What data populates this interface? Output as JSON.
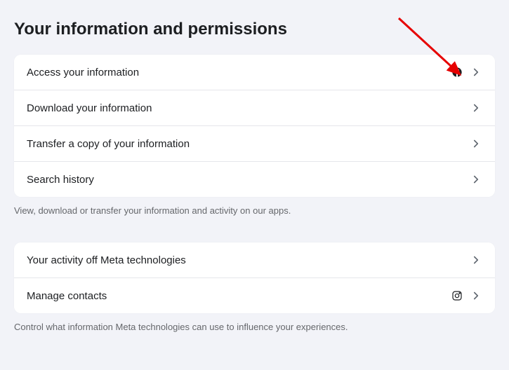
{
  "title": "Your information and permissions",
  "group1": {
    "items": [
      {
        "label": "Access your information",
        "icon": "facebook"
      },
      {
        "label": "Download your information",
        "icon": null
      },
      {
        "label": "Transfer a copy of your information",
        "icon": null
      },
      {
        "label": "Search history",
        "icon": null
      }
    ],
    "helper": "View, download or transfer your information and activity on our apps."
  },
  "group2": {
    "items": [
      {
        "label": "Your activity off Meta technologies",
        "icon": null
      },
      {
        "label": "Manage contacts",
        "icon": "instagram"
      }
    ],
    "helper": "Control what information Meta technologies can use to influence your experiences."
  }
}
